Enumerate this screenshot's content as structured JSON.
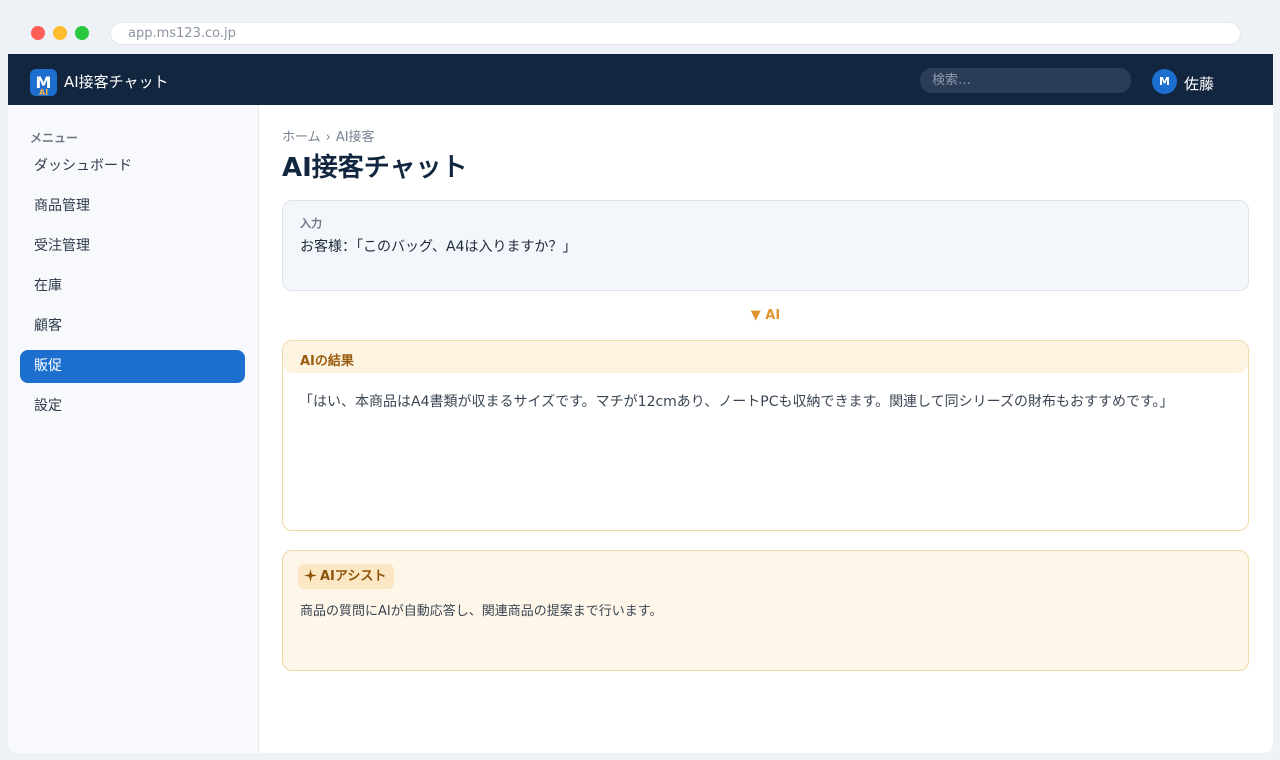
{
  "browser": {
    "url": "app.ms123.co.jp"
  },
  "header": {
    "logo_letter": "M",
    "logo_sub": "AI",
    "app_title": "AI接客チャット",
    "search_placeholder": "検索…",
    "avatar_letter": "M",
    "username": "佐藤"
  },
  "sidebar": {
    "heading": "メニュー",
    "items": [
      {
        "label": "ダッシュボード",
        "active": false
      },
      {
        "label": "商品管理",
        "active": false
      },
      {
        "label": "受注管理",
        "active": false
      },
      {
        "label": "在庫",
        "active": false
      },
      {
        "label": "顧客",
        "active": false
      },
      {
        "label": "販促",
        "active": true
      },
      {
        "label": "設定",
        "active": false
      }
    ]
  },
  "main": {
    "breadcrumb": [
      "ホーム",
      "AI接客"
    ],
    "breadcrumb_separator": "›",
    "title": "AI接客チャット",
    "input_card": {
      "label": "入力",
      "text": "お客様：「このバッグ、A4は入りますか？」"
    },
    "ai_flow_label": "▼ AI",
    "result_card": {
      "title": "AIの結果",
      "text": "「はい、本商品はA4書類が収まるサイズです。マチが12cmあり、ノートPCも収納できます。関連して同シリーズの財布もおすすめです。」"
    },
    "assist_card": {
      "badge": "AIアシスト",
      "icon": "sparkle-icon",
      "description": "商品の質問にAIが自動応答し、関連商品の提案まで行います。"
    }
  },
  "colors": {
    "topbar": "#13263f",
    "accent": "#1d6fcf",
    "ai_orange": "#e0962f",
    "assist_bg": "#fef6e8"
  }
}
